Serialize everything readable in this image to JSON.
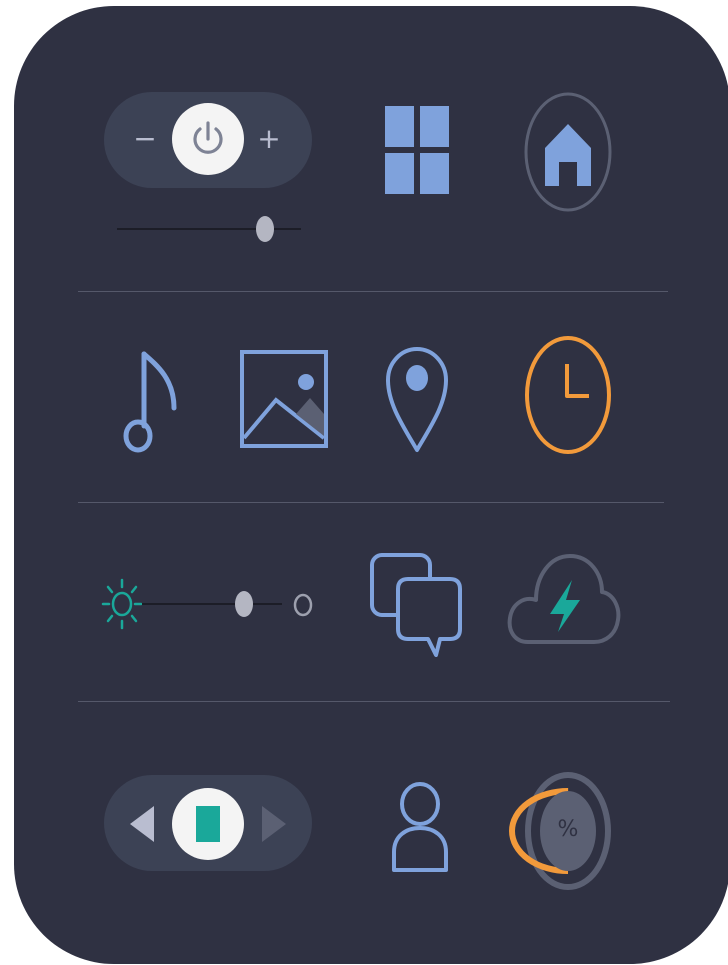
{
  "colors": {
    "panel_bg": "#2f3142",
    "pill_bg": "#3c4255",
    "accent_blue": "#7fa2dc",
    "accent_orange": "#f29a3b",
    "accent_teal": "#1aa89a",
    "muted_gray": "#5b6073",
    "knob_white": "#f4f4f4",
    "divider": "#55586a"
  },
  "power_control": {
    "minus_label": "−",
    "plus_label": "+",
    "icon": "power-icon"
  },
  "power_slider": {
    "level": 0.85
  },
  "row1_icons": [
    "grid-icon",
    "home-icon"
  ],
  "row2_icons": [
    "music-note-icon",
    "image-icon",
    "location-pin-icon",
    "clock-icon"
  ],
  "brightness": {
    "icon_low": "sun-icon",
    "icon_high": "circle-icon",
    "level": 0.78
  },
  "row3_icons": [
    "chat-bubbles-icon",
    "cloud-lightning-icon"
  ],
  "media_control": {
    "prev_icon": "prev-arrow-icon",
    "stop_icon": "stop-icon",
    "next_icon": "next-arrow-icon"
  },
  "row4_icons": [
    "user-icon"
  ],
  "percent_gauge": {
    "label": "%",
    "level": 0.5
  }
}
